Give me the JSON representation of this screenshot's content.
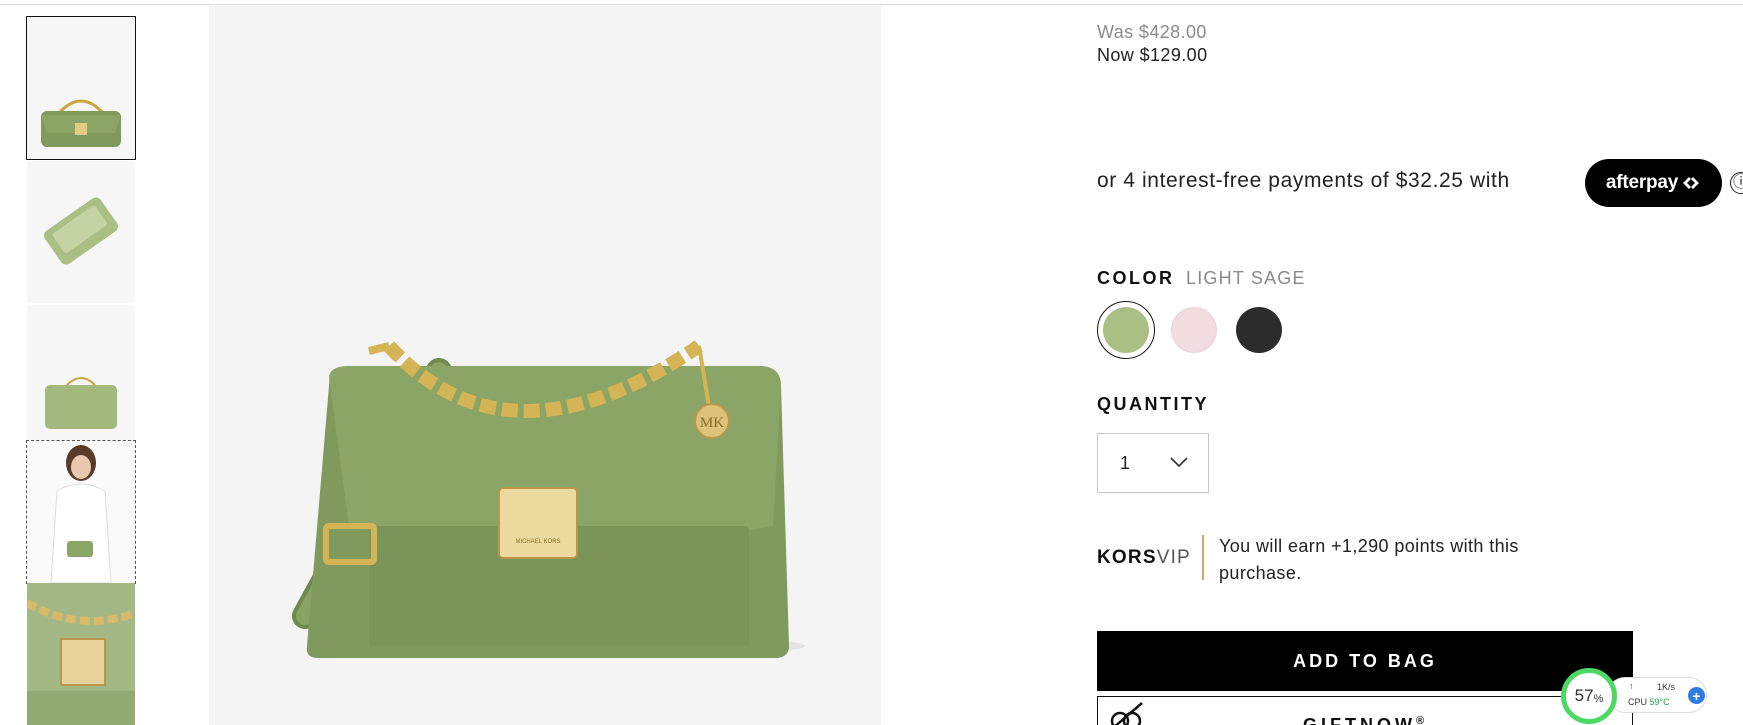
{
  "gallery": {
    "thumbnails": [
      {
        "name": "thumbnail-front",
        "selected": true
      },
      {
        "name": "thumbnail-open",
        "selected": false
      },
      {
        "name": "thumbnail-back",
        "selected": false
      },
      {
        "name": "thumbnail-model",
        "selected": false
      },
      {
        "name": "thumbnail-detail",
        "selected": false
      }
    ],
    "main_image": {
      "icon": "green-handbag-image",
      "brand_text": "MICHAEL KORS",
      "charm_text": "MK"
    }
  },
  "pricing": {
    "was": "Was $428.00",
    "now": "Now $129.00"
  },
  "afterpay": {
    "text": "or 4 interest-free payments of $32.25 with",
    "logo_text": "afterpay",
    "info_icon": "ⓘ"
  },
  "color": {
    "label": "COLOR",
    "selected": "LIGHT SAGE",
    "swatches": [
      {
        "name": "light-sage",
        "hex": "#a9bf84",
        "selected": true
      },
      {
        "name": "pink",
        "hex": "#f1dde0",
        "selected": false
      },
      {
        "name": "black",
        "hex": "#2c2c2c",
        "selected": false
      }
    ]
  },
  "quantity": {
    "label": "QUANTITY",
    "value": "1"
  },
  "korsvip": {
    "brand_bold": "KORS",
    "brand_light": "VIP",
    "text": "You will earn +1,290 points with this purchase."
  },
  "actions": {
    "add_to_bag": "ADD TO BAG",
    "giftnow": "GIFTNOW",
    "giftnow_mark": "®"
  },
  "system_widget": {
    "percent": "57",
    "percent_sign": "%",
    "net_speed": "1K/s",
    "cpu_label": "CPU",
    "cpu_temp": "59°C",
    "plus": "+"
  },
  "colors": {
    "bag_green": "#7f9a5c",
    "accent_gold": "#c7a86a",
    "widget_green": "#4cd964"
  }
}
